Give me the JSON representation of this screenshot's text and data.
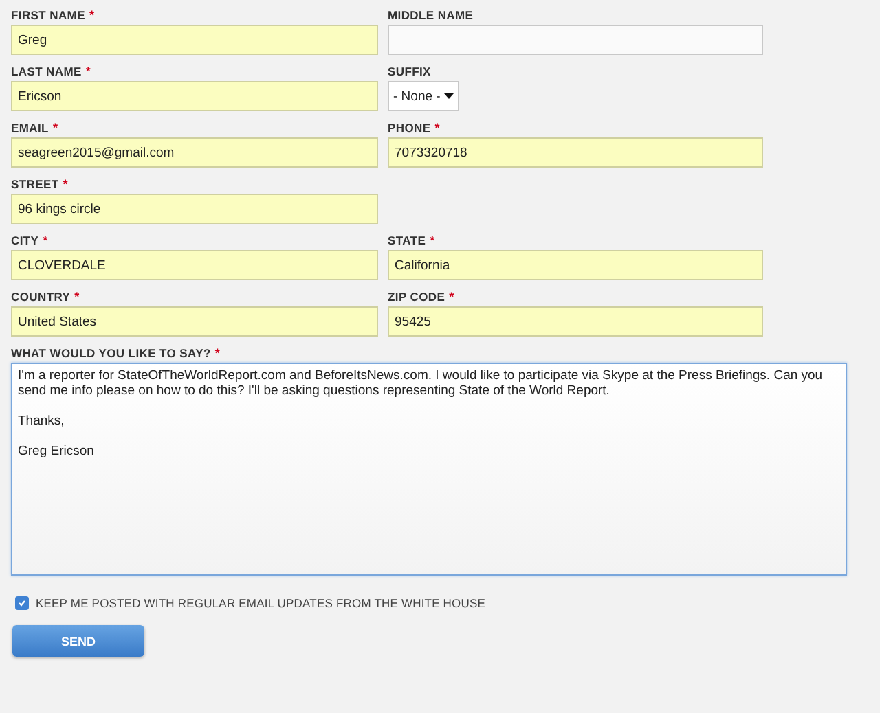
{
  "rows": [
    {
      "fields": [
        {
          "kind": "text",
          "label": "FIRST NAME",
          "required_mark": "*",
          "value": "Greg"
        },
        {
          "kind": "text",
          "label": "MIDDLE NAME"
        }
      ]
    },
    {
      "fields": [
        {
          "kind": "text",
          "label": "LAST NAME",
          "required_mark": "*",
          "value": "Ericson"
        },
        {
          "kind": "select",
          "label": "SUFFIX",
          "value": "- None -"
        }
      ]
    },
    {
      "fields": [
        {
          "kind": "text",
          "label": "EMAIL",
          "required_mark": "*",
          "value": "seagreen2015@gmail.com"
        },
        {
          "kind": "text",
          "label": "PHONE",
          "required_mark": "*",
          "value": "7073320718"
        }
      ]
    },
    {
      "fields": [
        {
          "kind": "text",
          "label": "STREET",
          "required_mark": "*",
          "value": "96 kings circle"
        }
      ]
    },
    {
      "fields": [
        {
          "kind": "text",
          "label": "CITY",
          "required_mark": "*",
          "value": "CLOVERDALE"
        },
        {
          "kind": "text",
          "label": "STATE",
          "required_mark": "*",
          "value": "California"
        }
      ]
    },
    {
      "fields": [
        {
          "kind": "text",
          "label": "COUNTRY",
          "required_mark": "*",
          "value": "United States"
        },
        {
          "kind": "text",
          "label": "ZIP CODE",
          "required_mark": "*",
          "value": "95425"
        }
      ]
    }
  ],
  "message": {
    "label": "WHAT WOULD YOU LIKE TO SAY?",
    "required_mark": "*",
    "value": "I'm a reporter for StateOfTheWorldReport.com and BeforeItsNews.com. I would like to participate via Skype at the Press Briefings. Can you send me info please on how to do this? I'll be asking questions representing State of the World Report.\n\nThanks,\n\nGreg Ericson",
    "focused": true
  },
  "updates": {
    "label": "KEEP ME POSTED WITH REGULAR EMAIL UPDATES FROM THE WHITE HOUSE",
    "checked": true
  },
  "submit": {
    "label": "SEND"
  }
}
